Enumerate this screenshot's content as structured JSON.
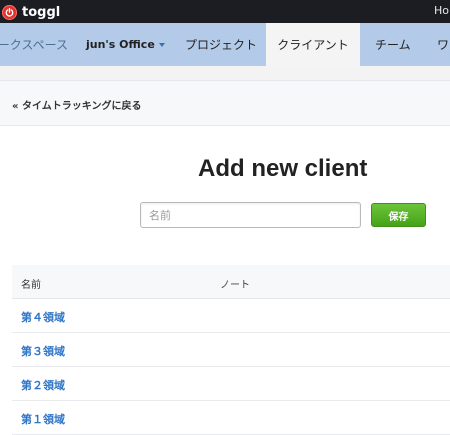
{
  "topbar": {
    "logo_text": "toggl",
    "right_text": "Ho"
  },
  "nav": {
    "workspaces": "ワークスペース",
    "office": "jun's Office",
    "projects": "プロジェクト",
    "clients": "クライアント",
    "team": "チーム",
    "more": "ワ"
  },
  "back_link": "« タイムトラッキングに戻る",
  "heading": "Add new client",
  "form": {
    "placeholder": "名前",
    "save_label": "保存"
  },
  "table": {
    "col_name": "名前",
    "col_note": "ノート",
    "rows": [
      "第４領域",
      "第３領域",
      "第２領域",
      "第１領域"
    ]
  },
  "colors": {
    "topbar": "#1b1d22",
    "nav": "#b3cbe9",
    "active_tab": "#f4f4f4",
    "save_green": "#45a317",
    "link_blue": "#2f76c9"
  }
}
